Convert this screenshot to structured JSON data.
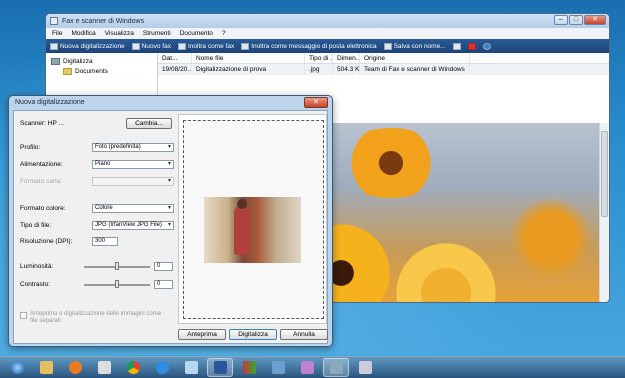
{
  "fax_window": {
    "title": "Fax e scanner di Windows",
    "menu": [
      "File",
      "Modifica",
      "Visualizza",
      "Strumenti",
      "Documento",
      "?"
    ],
    "toolbar": {
      "new_scan": "Nuova digitalizzazione",
      "new_fax": "Nuovo fax",
      "forward_fax": "Inoltra come fax",
      "forward_email": "Inoltra come messaggio di posta elettronica",
      "save_as": "Salva con nome..."
    },
    "tree": {
      "root": "Digitalizza",
      "child": "Documents"
    },
    "columns": [
      "Dat...",
      "Nome file",
      "Tipo di ...",
      "Dimen...",
      "Origine"
    ],
    "rows": [
      [
        "19/08/20...",
        "Digitalizzazione di prova",
        ".jpg",
        "504.3 KB",
        "Team di Fax e scanner di Windows"
      ]
    ]
  },
  "dialog": {
    "title": "Nuova digitalizzazione",
    "scanner_label": "Scanner: HP ...",
    "change_button": "Cambia...",
    "profile_label": "Profilo:",
    "profile_value": "Foto (predefinita)",
    "source_label": "Alimentazione:",
    "source_value": "Piano",
    "paper_label": "Formato carta:",
    "paper_value": "",
    "color_label": "Formato colore:",
    "color_value": "Colore",
    "filetype_label": "Tipo di file:",
    "filetype_value": "JPG (IrfanView JPG File)",
    "resolution_label": "Risoluzione (DPI):",
    "resolution_value": "300",
    "brightness_label": "Luminosità:",
    "brightness_value": "0",
    "contrast_label": "Contrasto:",
    "contrast_value": "0",
    "separate_files_label_1": "Anteprima o digitalizzazione delle immagini come",
    "separate_files_label_2": "file separati",
    "preview_button": "Anteprima",
    "scan_button": "Digitalizza",
    "cancel_button": "Annulla"
  },
  "colors": {
    "toolbar": "#1c4378",
    "title_bar": "#bcd4ec",
    "close": "#c8412a"
  }
}
